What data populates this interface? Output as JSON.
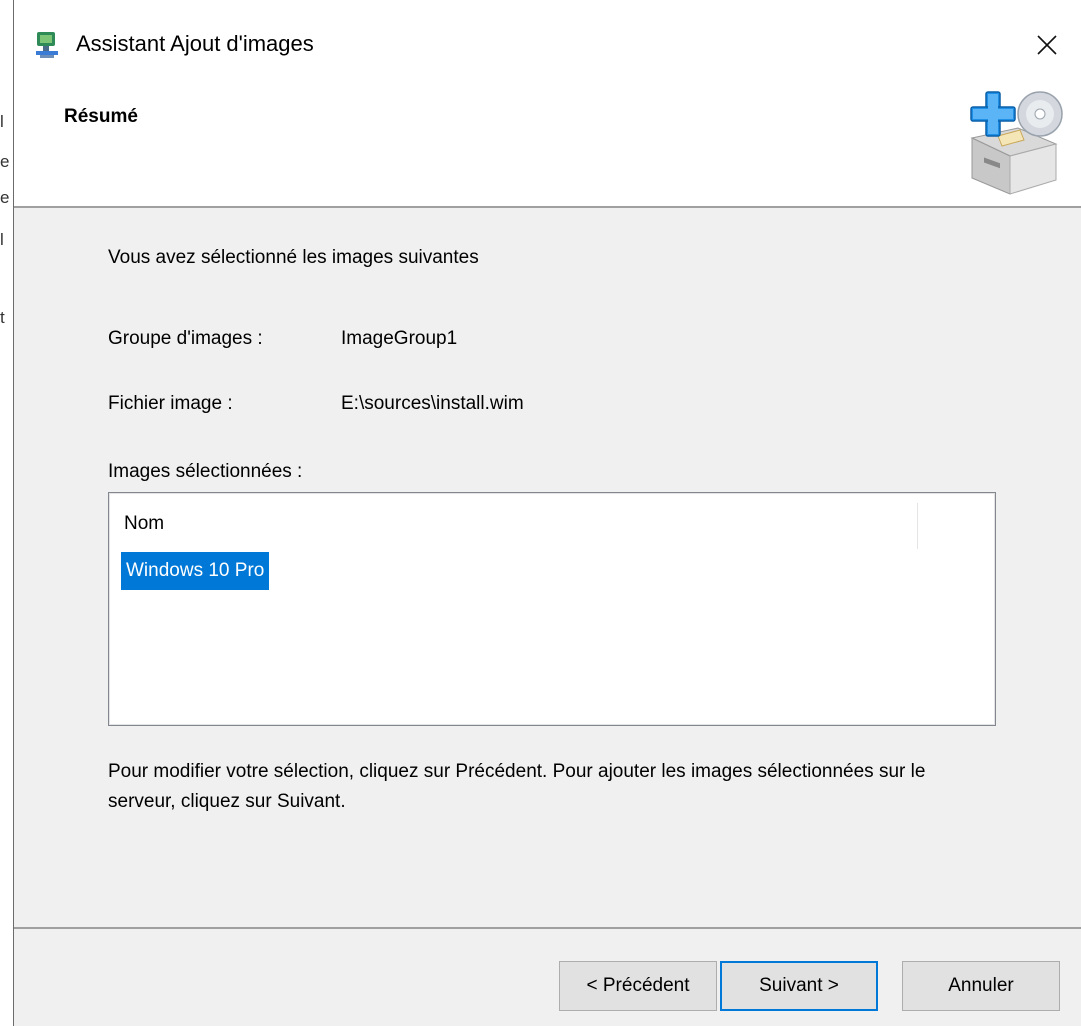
{
  "window": {
    "title": "Assistant Ajout d'images",
    "close_icon": "close-icon"
  },
  "header": {
    "title": "Résumé",
    "icon": "add-image-archive-icon"
  },
  "summary": {
    "intro": "Vous avez sélectionné les images suivantes",
    "group_label": "Groupe d'images :",
    "group_value": "ImageGroup1",
    "file_label": "Fichier image :",
    "file_value": "E:\\sources\\install.wim",
    "selected_label": "Images sélectionnées :"
  },
  "images_list": {
    "column_header": "Nom",
    "rows": [
      {
        "name": "Windows 10 Pro",
        "selected": true
      }
    ]
  },
  "instructions": "Pour modifier votre sélection, cliquez sur Précédent. Pour ajouter les images sélectionnées sur le serveur, cliquez sur Suivant.",
  "buttons": {
    "previous": "< Précédent",
    "next": "Suivant >",
    "cancel": "Annuler"
  },
  "colors": {
    "selection": "#0078d7",
    "dialog_bg": "#f0f0f0"
  }
}
